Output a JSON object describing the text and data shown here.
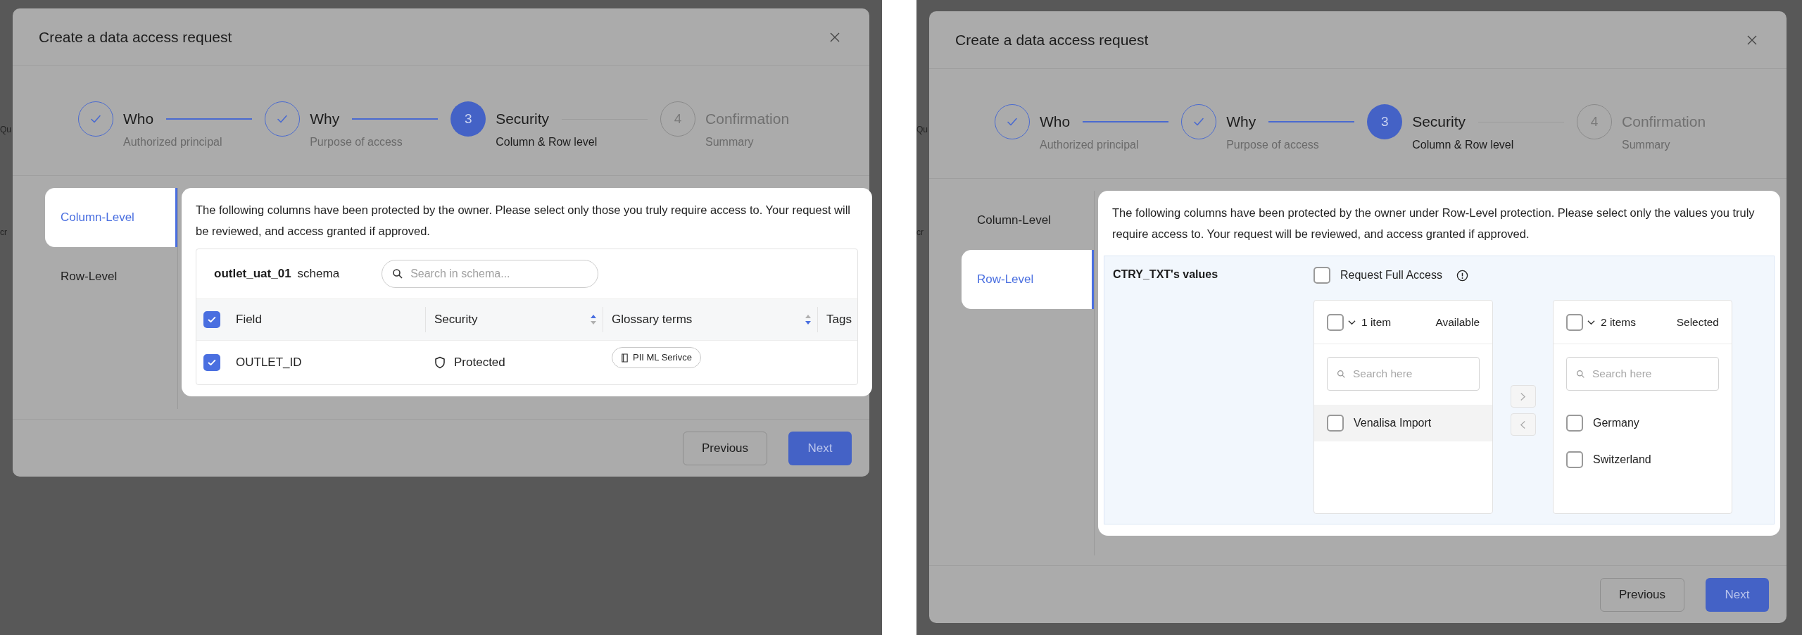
{
  "panels": [
    {
      "background_fragments": [
        "Qu",
        "cr"
      ],
      "dialog": {
        "title": "Create a data access request",
        "steps": [
          {
            "label": "Who",
            "caption": "Authorized principal",
            "done": true,
            "current": false
          },
          {
            "label": "Why",
            "caption": "Purpose of access",
            "done": true,
            "current": false
          },
          {
            "label": "Security",
            "caption": "Column & Row level",
            "done": false,
            "current": true,
            "number": "3"
          },
          {
            "label": "Confirmation",
            "caption": "Summary",
            "done": false,
            "current": false,
            "number": "4"
          }
        ],
        "tabs": [
          {
            "label": "Column-Level",
            "selected": true
          },
          {
            "label": "Row-Level",
            "selected": false
          }
        ],
        "content": {
          "kind": "column_level",
          "description": "The following columns have been protected by the owner. Please select only those you truly require access to. Your request will be reviewed, and access granted if approved.",
          "schema_name": "outlet_uat_01",
          "schema_suffix": "schema",
          "search_placeholder": "Search in schema...",
          "header_checked": true,
          "columns": [
            {
              "label": "Field"
            },
            {
              "label": "Security",
              "sort_ascending": true
            },
            {
              "label": "Glossary terms",
              "sort_ascending": false
            },
            {
              "label": "Tags"
            }
          ],
          "rows": [
            {
              "checked": true,
              "field": "OUTLET_ID",
              "security": "Protected",
              "glossary_term": "PII ML Serivce"
            }
          ]
        },
        "buttons": [
          {
            "label": "Previous",
            "kind": "secondary"
          },
          {
            "label": "Next",
            "kind": "primary"
          }
        ]
      }
    },
    {
      "background_fragments": [
        "Qu",
        "cr"
      ],
      "dialog": {
        "title": "Create a data access request",
        "steps": [
          {
            "label": "Who",
            "caption": "Authorized principal",
            "done": true,
            "current": false
          },
          {
            "label": "Why",
            "caption": "Purpose of access",
            "done": true,
            "current": false
          },
          {
            "label": "Security",
            "caption": "Column & Row level",
            "done": false,
            "current": true,
            "number": "3"
          },
          {
            "label": "Confirmation",
            "caption": "Summary",
            "done": false,
            "current": false,
            "number": "4"
          }
        ],
        "tabs": [
          {
            "label": "Column-Level",
            "selected": false
          },
          {
            "label": "Row-Level",
            "selected": true
          }
        ],
        "content": {
          "kind": "row_level",
          "description": "The following columns have been protected by the owner under Row-Level protection. Please select only the values you truly require access to. Your request will be reviewed, and access granted if approved.",
          "attribute": "CTRY_TXT's values",
          "full_access": {
            "label": "Request Full Access",
            "checked": false
          },
          "lists": [
            {
              "checked": false,
              "count": "1 item",
              "title": "Available",
              "placeholder": "Search here",
              "items": [
                {
                  "label": "Venalisa Import",
                  "checked": false,
                  "highlighted": true
                }
              ]
            },
            {
              "checked": false,
              "count": "2 items",
              "title": "Selected",
              "placeholder": "Search here",
              "items": [
                {
                  "label": "Germany",
                  "checked": false,
                  "highlighted": false
                },
                {
                  "label": "Switzerland",
                  "checked": false,
                  "highlighted": false
                }
              ]
            }
          ]
        },
        "buttons": [
          {
            "label": "Previous",
            "kind": "secondary"
          },
          {
            "label": "Next",
            "kind": "primary"
          }
        ]
      }
    }
  ]
}
